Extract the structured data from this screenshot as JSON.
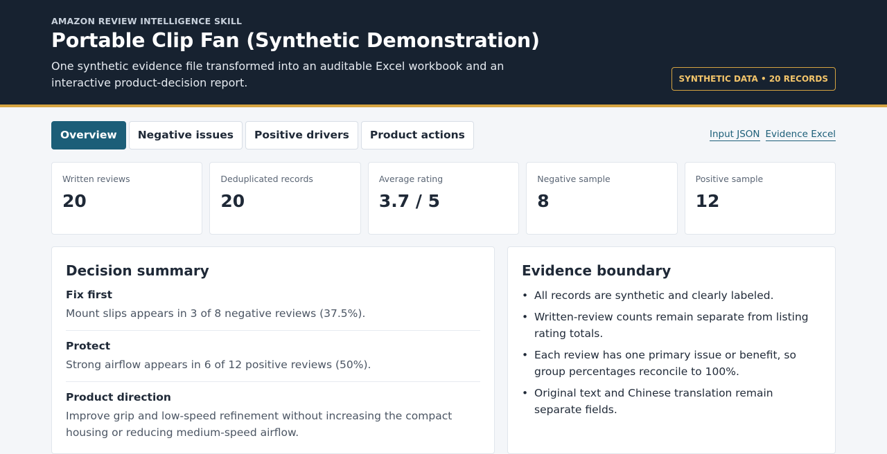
{
  "header": {
    "eyebrow": "AMAZON REVIEW INTELLIGENCE SKILL",
    "title": "Portable Clip Fan (Synthetic Demonstration)",
    "subtitle": "One synthetic evidence file transformed into an auditable Excel workbook and an interactive product-decision report.",
    "badge": "SYNTHETIC DATA • 20 RECORDS"
  },
  "tabs": [
    {
      "label": "Overview",
      "active": true
    },
    {
      "label": "Negative issues",
      "active": false
    },
    {
      "label": "Positive drivers",
      "active": false
    },
    {
      "label": "Product actions",
      "active": false
    }
  ],
  "links": {
    "input_json": "Input JSON",
    "evidence_excel": "Evidence Excel"
  },
  "kpis": [
    {
      "label": "Written reviews",
      "value": "20"
    },
    {
      "label": "Deduplicated records",
      "value": "20"
    },
    {
      "label": "Average rating",
      "value": "3.7 / 5"
    },
    {
      "label": "Negative sample",
      "value": "8"
    },
    {
      "label": "Positive sample",
      "value": "12"
    }
  ],
  "decision_summary": {
    "title": "Decision summary",
    "sections": [
      {
        "heading": "Fix first",
        "text": "Mount slips appears in 3 of 8 negative reviews (37.5%)."
      },
      {
        "heading": "Protect",
        "text": "Strong airflow appears in 6 of 12 positive reviews (50%)."
      },
      {
        "heading": "Product direction",
        "text": "Improve grip and low-speed refinement without increasing the compact housing or reducing medium-speed airflow."
      }
    ]
  },
  "evidence_boundary": {
    "title": "Evidence boundary",
    "bullet": "•",
    "items": [
      "All records are synthetic and clearly labeled.",
      "Written-review counts remain separate from listing rating totals.",
      "Each review has one primary issue or benefit, so group percentages reconcile to 100%.",
      "Original text and Chinese translation remain separate fields."
    ]
  },
  "colors": {
    "header_bg": "#172230",
    "accent_gold": "#d6a441",
    "tab_active": "#1c5e78"
  }
}
